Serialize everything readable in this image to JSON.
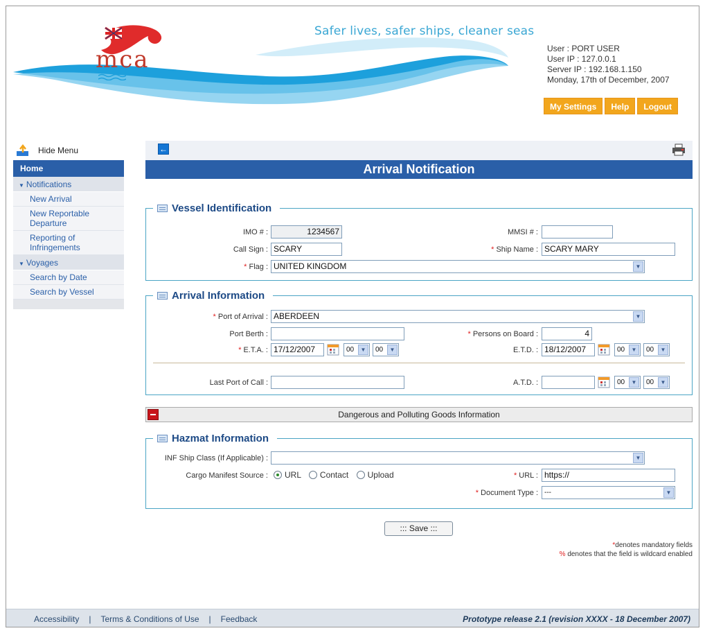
{
  "header": {
    "tagline": "Safer lives,  safer ships, cleaner seas",
    "logo_text": "mca",
    "user_line": "User : PORT USER",
    "ip_line": "User IP : 127.0.0.1",
    "server_line": "Server IP : 192.168.1.150",
    "date_line": "Monday, 17th of December, 2007",
    "buttons": [
      "My Settings",
      "Help",
      "Logout"
    ],
    "colors": {
      "button": "#f2a61d",
      "wave": "#1da0dc",
      "flag_red": "#e02b2b"
    }
  },
  "sidebar": {
    "hide_menu": "Hide Menu",
    "home": "Home",
    "sections": [
      {
        "label": "Notifications",
        "items": [
          "New Arrival",
          "New Reportable Departure",
          "Reporting of Infringements"
        ]
      },
      {
        "label": "Voyages",
        "items": [
          "Search by Date",
          "Search by Vessel"
        ]
      }
    ]
  },
  "page": {
    "title": "Arrival Notification"
  },
  "vessel": {
    "legend": "Vessel Identification",
    "imo_label": "IMO # :",
    "imo_value": "1234567",
    "mmsi_label": "MMSI # :",
    "mmsi_value": "",
    "callsign_label": "Call Sign :",
    "callsign_value": "SCARY",
    "shipname_label": "Ship Name :",
    "shipname_value": "SCARY MARY",
    "flag_label": "Flag :",
    "flag_value": "UNITED KINGDOM"
  },
  "arrival": {
    "legend": "Arrival Information",
    "port_label": "Port of Arrival :",
    "port_value": "ABERDEEN",
    "berth_label": "Port Berth :",
    "berth_value": "",
    "pob_label": "Persons on Board :",
    "pob_value": "4",
    "eta_label": "E.T.A. :",
    "eta_date": "17/12/2007",
    "eta_hh": "00",
    "eta_mm": "00",
    "etd_label": "E.T.D. :",
    "etd_date": "18/12/2007",
    "etd_hh": "00",
    "etd_mm": "00",
    "lpoc_label": "Last Port of Call :",
    "lpoc_value": "",
    "atd_label": "A.T.D. :",
    "atd_date": "",
    "atd_hh": "00",
    "atd_mm": "00"
  },
  "dangerous": {
    "label": "Dangerous and Polluting Goods Information"
  },
  "hazmat": {
    "legend": "Hazmat Information",
    "inf_label": "INF Ship Class (If Applicable) :",
    "inf_value": "",
    "cargo_label": "Cargo Manifest Source :",
    "options": [
      "URL",
      "Contact",
      "Upload"
    ],
    "selected": "URL",
    "url_label": "URL :",
    "url_value": "https://",
    "doctype_label": "Document Type :",
    "doctype_value": "---"
  },
  "actions": {
    "save": "::: Save :::"
  },
  "notes": {
    "mandatory": "denotes mandatory fields",
    "wildcard": "denotes that the field is wildcard enabled",
    "star": "*",
    "percent": "%"
  },
  "footer": {
    "links": [
      "Accessibility",
      "Terms & Conditions of Use",
      "Feedback"
    ],
    "sep": "|",
    "release": "Prototype release 2.1 (revision XXXX - 18 December 2007)"
  }
}
